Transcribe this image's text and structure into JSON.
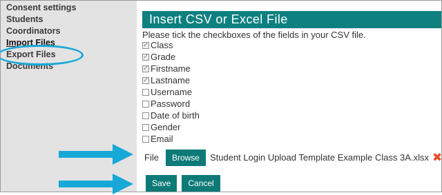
{
  "sidebar": {
    "items": [
      {
        "label": "Consent settings"
      },
      {
        "label": "Students"
      },
      {
        "label": "Coordinators"
      },
      {
        "label": "Import Files"
      },
      {
        "label": "Export Files"
      },
      {
        "label": "Documents"
      }
    ],
    "active_item": "Import Files"
  },
  "main": {
    "title": "Insert CSV or Excel File",
    "instruction": "Please tick the checkboxes of the fields in your CSV file.",
    "fields": [
      {
        "label": "Class",
        "checked": true
      },
      {
        "label": "Grade",
        "checked": true
      },
      {
        "label": "Firstname",
        "checked": true
      },
      {
        "label": "Lastname",
        "checked": true
      },
      {
        "label": "Username",
        "checked": false
      },
      {
        "label": "Password",
        "checked": false
      },
      {
        "label": "Date of birth",
        "checked": false
      },
      {
        "label": "Gender",
        "checked": false
      },
      {
        "label": "Email",
        "checked": false
      }
    ],
    "file": {
      "label": "File",
      "browse_label": "Browse",
      "filename": "Student Login Upload Template Example Class 3A.xlsx"
    },
    "actions": {
      "save_label": "Save",
      "cancel_label": "Cancel"
    }
  },
  "colors": {
    "accent": "#0e8080",
    "button": "#0e7a78",
    "annotation": "#18a8d8",
    "remove": "#e44d2c",
    "sidebar_bg": "#e3e3e3"
  },
  "icons": {
    "remove_file": "close-icon",
    "annotation_arrows": "arrow-right-icon",
    "annotation_ring": "highlight-ellipse"
  }
}
